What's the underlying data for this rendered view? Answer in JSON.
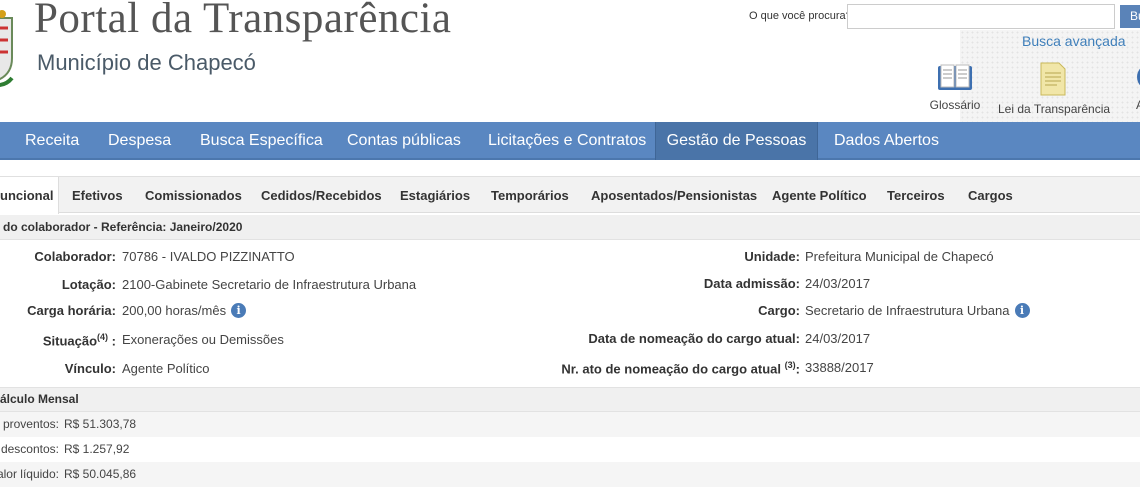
{
  "header": {
    "title": "Portal da Transparência",
    "subtitle": "Município de Chapecó",
    "search_label": "O que você procura?",
    "search_placeholder": "",
    "search_button": "Bu",
    "busca_avancada": "Busca avançada",
    "tools": [
      {
        "label": "Glossário",
        "icon": "book-icon"
      },
      {
        "label": "Lei da Transparência",
        "icon": "document-icon"
      },
      {
        "label": "A",
        "icon": "globe-icon"
      }
    ]
  },
  "topnav": {
    "items": [
      "Receita",
      "Despesa",
      "Busca Específica",
      "Contas públicas",
      "Licitações e Contratos",
      "Gestão de Pessoas",
      "Dados Abertos"
    ],
    "active": "Gestão de Pessoas",
    "color": "#5a87c1"
  },
  "subtabs": {
    "items": [
      "uncional",
      "Efetivos",
      "Comissionados",
      "Cedidos/Recebidos",
      "Estagiários",
      "Temporários",
      "Aposentados/Pensionistas",
      "Agente Político",
      "Terceiros",
      "Cargos"
    ],
    "active": "uncional"
  },
  "section_title": "do colaborador - Referência: Janeiro/2020",
  "details": {
    "colaborador": {
      "label": "Colaborador:",
      "value": "70786 - IVALDO PIZZINATTO"
    },
    "lotacao": {
      "label": "Lotação:",
      "value": "2100-Gabinete Secretario de Infraestrutura Urbana"
    },
    "carga": {
      "label": "Carga horária:",
      "value": "200,00 horas/mês"
    },
    "situacao": {
      "label": "Situação",
      "sup": "(4)",
      "label_suffix": " :",
      "value": "Exonerações ou Demissões"
    },
    "vinculo": {
      "label": "Vínculo:",
      "value": "Agente Político"
    },
    "unidade": {
      "label": "Unidade:",
      "value": "Prefeitura Municipal de Chapecó"
    },
    "data_admissao": {
      "label": "Data admissão:",
      "value": "24/03/2017"
    },
    "cargo": {
      "label": "Cargo:",
      "value": "Secretario de Infraestrutura Urbana"
    },
    "data_nomeacao": {
      "label": "Data de nomeação do cargo atual:",
      "value": "24/03/2017"
    },
    "nr_ato": {
      "label": "Nr. ato de nomeação do cargo atual",
      "sup": "(3)",
      "label_suffix": ":",
      "value": "33888/2017"
    },
    "info_icon": "i"
  },
  "calculo": {
    "title": "álculo Mensal",
    "rows": [
      {
        "label": "s proventos:",
        "value": "R$ 51.303,78"
      },
      {
        "label": "descontos:",
        "value": "R$ 1.257,92"
      },
      {
        "label": "alor líquido:",
        "value": "R$ 50.045,86"
      }
    ]
  }
}
